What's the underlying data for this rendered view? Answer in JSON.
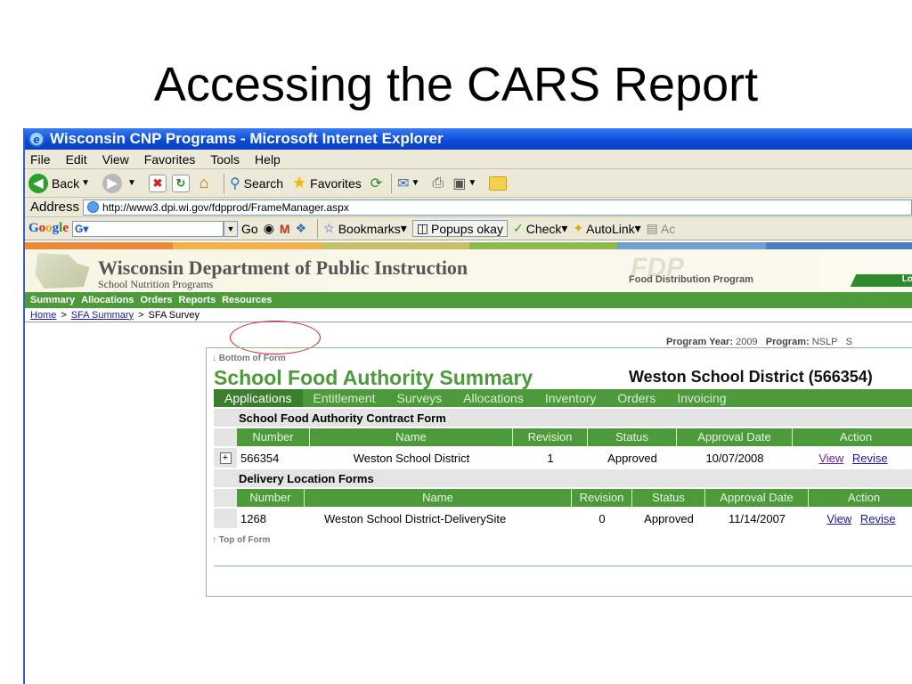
{
  "slide": {
    "title": "Accessing the CARS Report"
  },
  "browser": {
    "window_title": "Wisconsin CNP Programs - Microsoft Internet Explorer",
    "menu": [
      "File",
      "Edit",
      "View",
      "Favorites",
      "Tools",
      "Help"
    ],
    "toolbar": {
      "back": "Back",
      "search": "Search",
      "favorites": "Favorites"
    },
    "address": {
      "label": "Address",
      "url": "http://www3.dpi.wi.gov/fdpprod/FrameManager.aspx"
    },
    "googlebar": {
      "go": "Go",
      "bookmarks": "Bookmarks",
      "popups": "Popups okay",
      "check": "Check",
      "autolink": "AutoLink",
      "more": "Ac"
    }
  },
  "site": {
    "header": {
      "dept": "Wisconsin Department of Public Instruction",
      "sub": "School Nutrition Programs",
      "fdp_mark": "FDP",
      "fdp_name": "Food Distribution Program",
      "login": "Lo"
    },
    "nav": [
      "Summary",
      "Allocations",
      "Orders",
      "Reports",
      "Resources"
    ],
    "breadcrumb": {
      "home": "Home",
      "summary": "SFA Summary",
      "current": "SFA Survey"
    },
    "program_line": {
      "year_label": "Program Year:",
      "year": "2009",
      "program_label": "Program:",
      "program": "NSLP",
      "extra": "S"
    }
  },
  "panel": {
    "bottom_link": "Bottom of Form",
    "top_link": "Top of Form",
    "title": "School Food Authority Summary",
    "district": "Weston School District (566354)",
    "tabs": [
      "Applications",
      "Entitlement",
      "Surveys",
      "Allocations",
      "Inventory",
      "Orders",
      "Invoicing"
    ],
    "contract": {
      "heading": "School Food Authority Contract Form",
      "columns": [
        "Number",
        "Name",
        "Revision",
        "Status",
        "Approval Date",
        "Action"
      ],
      "row": {
        "number": "566354",
        "name": "Weston School District",
        "revision": "1",
        "status": "Approved",
        "date": "10/07/2008",
        "view": "View",
        "revise": "Revise"
      }
    },
    "delivery": {
      "heading": "Delivery Location Forms",
      "columns": [
        "Number",
        "Name",
        "Revision",
        "Status",
        "Approval Date",
        "Action"
      ],
      "row": {
        "number": "1268",
        "name": "Weston School District-DeliverySite",
        "revision": "0",
        "status": "Approved",
        "date": "11/14/2007",
        "view": "View",
        "revise": "Revise"
      }
    }
  }
}
